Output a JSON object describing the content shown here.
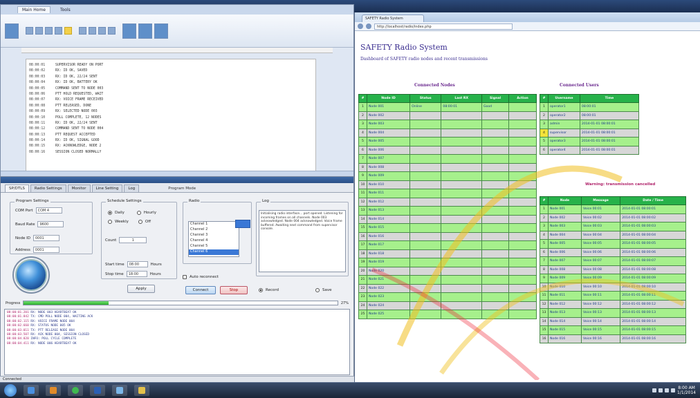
{
  "word": {
    "tabs": [
      "Main Home",
      "Tools"
    ],
    "doc_lines": [
      {
        "ts": "08:00:01",
        "text": "SUPERVISOR READY ON PORT"
      },
      {
        "ts": "08:00:02",
        "text": "RX: ID OK, SAVED"
      },
      {
        "ts": "08:00:03",
        "text": "RX: ID OK, 22/24 SENT"
      },
      {
        "ts": "08:00:04",
        "text": "RX: ID OK, BATTERY OK"
      },
      {
        "ts": "08:00:05",
        "text": "COMMAND SENT TO NODE 003"
      },
      {
        "ts": "08:00:06",
        "text": "PTT HOLD REQUESTED, WAIT"
      },
      {
        "ts": "08:00:07",
        "text": "RX: VOICE FRAME RECEIVED"
      },
      {
        "ts": "08:00:08",
        "text": "PTT RELEASED, DONE"
      },
      {
        "ts": "08:00:09",
        "text": "RX: SELECTED NODE 003"
      },
      {
        "ts": "08:00:10",
        "text": "POLL COMPLETE, 12 NODES"
      },
      {
        "ts": "08:00:11",
        "text": "RX: ID OK, 22/24 SENT"
      },
      {
        "ts": "08:00:12",
        "text": "COMMAND SENT TO NODE 004"
      },
      {
        "ts": "08:00:13",
        "text": "PTT REQUEST ACCEPTED"
      },
      {
        "ts": "08:00:14",
        "text": "RX: ID OK, SIGNAL GOOD"
      },
      {
        "ts": "08:00:15",
        "text": "RX: ACKNOWLEDGE, NODE 2"
      },
      {
        "ts": "08:00:16",
        "text": "SESSION CLOSED NORMALLY"
      }
    ]
  },
  "tool": {
    "tabs": [
      "SP/DTLS",
      "Radio Settings",
      "Monitor",
      "Line Setting",
      "Log"
    ],
    "window_label": "Program Mode",
    "groups": {
      "program": "Program Settings",
      "schedule": "Schedule Settings",
      "radio": "Radio",
      "log": "Log"
    },
    "program": {
      "port_label": "COM Port",
      "port_value": "COM 4",
      "rate_label": "Baud Rate",
      "rate_value": "9600",
      "mode_label": "Node ID",
      "mode_value": "0001",
      "addr_label": "Address",
      "addr_value": "0001"
    },
    "schedule": {
      "opt1": "Daily",
      "opt2": "Hourly",
      "opt3": "Weekly",
      "opt4": "Off",
      "count_value": "1",
      "count_label": "Count",
      "start_label": "Start time",
      "start_value": "08:00",
      "stop_label": "Stop time",
      "stop_value": "18:00",
      "unit": "Hours"
    },
    "radio_list": [
      "Channel 1",
      "Channel 2",
      "Channel 3",
      "Channel 4",
      "Channel 5",
      "Channel 6"
    ],
    "radio_selected": "Channel 6",
    "log_text": "Initialising radio interface... port opened. Listening for incoming frames on all channels. Node 003 acknowledged. Node 004 acknowledged. Voice frame buffered. Awaiting next command from supervisor console.",
    "buttons": {
      "apply": "Apply",
      "connect": "Connect",
      "stop": "Stop",
      "record": "Record",
      "save": "Save"
    },
    "checkbox_label": "Auto reconnect",
    "progress_label": "Progress",
    "progress_value": 0.27,
    "progress_pct": "27%",
    "log_lines": [
      {
        "time": "08:00:01.201",
        "msg": "RX: NODE 003 HEARTBEAT OK"
      },
      {
        "time": "08:00:01.842",
        "msg": "TX: CMD POLL NODE 004, WAITING ACK"
      },
      {
        "time": "08:00:02.115",
        "msg": "RX: VOICE FRAME NODE 004"
      },
      {
        "time": "08:00:02.660",
        "msg": "RX: STATUS NODE 005 OK"
      },
      {
        "time": "08:00:03.011",
        "msg": "TX: PTT RELEASE NODE 004"
      },
      {
        "time": "08:00:03.507",
        "msg": "RX: ACK NODE 004, SESSION CLOSED"
      },
      {
        "time": "08:00:04.020",
        "msg": "INFO: POLL CYCLE COMPLETE"
      },
      {
        "time": "08:00:04.411",
        "msg": "RX: NODE 006 HEARTBEAT OK"
      }
    ],
    "status": "Connected"
  },
  "browser": {
    "tab_title": "SAFETY Radio System",
    "url": "http://localhost/radio/index.php",
    "page_title": "SAFETY Radio System",
    "page_subtitle": "Dashboard of SAFETY radio nodes and recent transmissions",
    "left_table": {
      "title": "Connected Nodes",
      "headers": [
        "#",
        "Node ID",
        "Status",
        "Last RX",
        "Signal",
        "Action"
      ],
      "rows": [
        {
          "num": "1",
          "cells": [
            "Node 001",
            "Online",
            "08:00:01",
            "Good",
            ""
          ]
        },
        {
          "num": "2",
          "cells": [
            "Node 002",
            "",
            "",
            "",
            ""
          ]
        },
        {
          "num": "3",
          "cells": [
            "Node 003",
            "",
            "",
            "",
            ""
          ]
        },
        {
          "num": "4",
          "cells": [
            "Node 004",
            "",
            "",
            "",
            ""
          ]
        },
        {
          "num": "5",
          "cells": [
            "Node 005",
            "",
            "",
            "",
            ""
          ]
        },
        {
          "num": "6",
          "cells": [
            "Node 006",
            "",
            "",
            "",
            ""
          ]
        },
        {
          "num": "7",
          "cells": [
            "Node 007",
            "",
            "",
            "",
            ""
          ]
        },
        {
          "num": "8",
          "cells": [
            "Node 008",
            "",
            "",
            "",
            ""
          ]
        },
        {
          "num": "9",
          "cells": [
            "Node 009",
            "",
            "",
            "",
            ""
          ]
        },
        {
          "num": "10",
          "cells": [
            "Node 010",
            "",
            "",
            "",
            ""
          ]
        },
        {
          "num": "11",
          "cells": [
            "Node 011",
            "",
            "",
            "",
            ""
          ]
        },
        {
          "num": "12",
          "cells": [
            "Node 012",
            "",
            "",
            "",
            ""
          ]
        },
        {
          "num": "13",
          "cells": [
            "Node 013",
            "",
            "",
            "",
            ""
          ]
        },
        {
          "num": "14",
          "cells": [
            "Node 014",
            "",
            "",
            "",
            ""
          ]
        },
        {
          "num": "15",
          "cells": [
            "Node 015",
            "",
            "",
            "",
            ""
          ]
        },
        {
          "num": "16",
          "cells": [
            "Node 016",
            "",
            "",
            "",
            ""
          ]
        },
        {
          "num": "17",
          "cells": [
            "Node 017",
            "",
            "",
            "",
            ""
          ]
        },
        {
          "num": "18",
          "cells": [
            "Node 018",
            "",
            "",
            "",
            ""
          ]
        },
        {
          "num": "19",
          "cells": [
            "Node 019",
            "",
            "",
            "",
            ""
          ]
        },
        {
          "num": "20",
          "cells": [
            "Node 020",
            "",
            "",
            "",
            ""
          ]
        },
        {
          "num": "21",
          "cells": [
            "Node 021",
            "",
            "",
            "",
            ""
          ]
        },
        {
          "num": "22",
          "cells": [
            "Node 022",
            "",
            "",
            "",
            ""
          ]
        },
        {
          "num": "23",
          "cells": [
            "Node 023",
            "",
            "",
            "",
            ""
          ]
        },
        {
          "num": "24",
          "cells": [
            "Node 024",
            "",
            "",
            "",
            ""
          ]
        },
        {
          "num": "25",
          "cells": [
            "Node 025",
            "",
            "",
            "",
            ""
          ]
        }
      ]
    },
    "right_table_1": {
      "title": "Connected Users",
      "headers": [
        "#",
        "Username",
        "Time"
      ],
      "rows": [
        {
          "num": "1",
          "yellow": false,
          "cells": [
            "operator1",
            "08:00:01"
          ]
        },
        {
          "num": "2",
          "yellow": false,
          "cells": [
            "operator2",
            "08:00:01"
          ]
        },
        {
          "num": "3",
          "yellow": false,
          "cells": [
            "admin",
            "2014-01-01 08:00:01"
          ]
        },
        {
          "num": "4",
          "yellow": true,
          "cells": [
            "supervisor",
            "2014-01-01 08:00:01"
          ]
        },
        {
          "num": "5",
          "yellow": false,
          "cells": [
            "operator3",
            "2014-01-01 08:00:01"
          ]
        },
        {
          "num": "6",
          "yellow": false,
          "cells": [
            "operator4",
            "2014-01-01 08:00:01"
          ]
        }
      ]
    },
    "warning": "Warning: transmission cancelled",
    "right_table_2": {
      "headers": [
        "#",
        "Node",
        "Message",
        "Date / Time"
      ],
      "rows": [
        {
          "num": "1",
          "cells": [
            "Node 001",
            "Voice 00:01",
            "2014-01-01 08:00:01"
          ]
        },
        {
          "num": "2",
          "cells": [
            "Node 002",
            "Voice 00:02",
            "2014-01-01 08:00:02"
          ]
        },
        {
          "num": "3",
          "cells": [
            "Node 003",
            "Voice 00:03",
            "2014-01-01 08:00:03"
          ]
        },
        {
          "num": "4",
          "cells": [
            "Node 004",
            "Voice 00:04",
            "2014-01-01 08:00:04"
          ]
        },
        {
          "num": "5",
          "cells": [
            "Node 005",
            "Voice 00:05",
            "2014-01-01 08:00:05"
          ]
        },
        {
          "num": "6",
          "cells": [
            "Node 006",
            "Voice 00:06",
            "2014-01-01 08:00:06"
          ]
        },
        {
          "num": "7",
          "cells": [
            "Node 007",
            "Voice 00:07",
            "2014-01-01 08:00:07"
          ]
        },
        {
          "num": "8",
          "cells": [
            "Node 008",
            "Voice 00:08",
            "2014-01-01 08:00:08"
          ]
        },
        {
          "num": "9",
          "cells": [
            "Node 009",
            "Voice 00:09",
            "2014-01-01 08:00:09"
          ]
        },
        {
          "num": "10",
          "cells": [
            "Node 010",
            "Voice 00:10",
            "2014-01-01 08:00:10"
          ]
        },
        {
          "num": "11",
          "cells": [
            "Node 011",
            "Voice 00:11",
            "2014-01-01 08:00:11"
          ]
        },
        {
          "num": "12",
          "cells": [
            "Node 012",
            "Voice 00:12",
            "2014-01-01 08:00:12"
          ]
        },
        {
          "num": "13",
          "cells": [
            "Node 013",
            "Voice 00:13",
            "2014-01-01 08:00:13"
          ]
        },
        {
          "num": "14",
          "cells": [
            "Node 014",
            "Voice 00:14",
            "2014-01-01 08:00:14"
          ]
        },
        {
          "num": "15",
          "cells": [
            "Node 015",
            "Voice 00:15",
            "2014-01-01 08:00:15"
          ]
        },
        {
          "num": "16",
          "cells": [
            "Node 016",
            "Voice 00:16",
            "2014-01-01 08:00:16"
          ]
        }
      ]
    }
  },
  "taskbar": {
    "time": "8:00 AM",
    "date": "1/1/2014",
    "apps": [
      "explorer-icon",
      "media-icon",
      "chrome-icon",
      "word-icon",
      "tool-icon",
      "folder-icon"
    ]
  },
  "colors": {
    "header_green": "#27b24a",
    "row_green": "#a6f08c",
    "row_gray": "#d7d7d7",
    "title_purple": "#3a2d8f",
    "highlight_yellow": "#f3e23a"
  }
}
